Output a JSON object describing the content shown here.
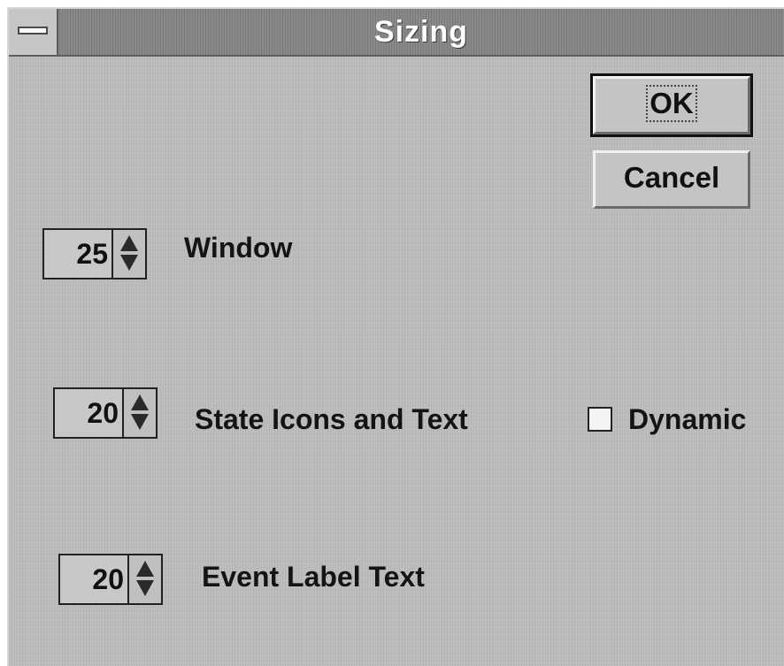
{
  "window": {
    "title": "Sizing"
  },
  "buttons": {
    "ok_label": "OK",
    "cancel_label": "Cancel"
  },
  "settings": [
    {
      "value": "25",
      "label": "Window"
    },
    {
      "value": "20",
      "label": "State Icons and Text"
    },
    {
      "value": "20",
      "label": "Event Label Text"
    }
  ],
  "dynamic_checkbox": {
    "label": "Dynamic",
    "checked": false
  },
  "icons": {
    "system_menu": "system-menu-icon",
    "spin_up": "arrow-up-icon",
    "spin_down": "arrow-down-icon"
  }
}
